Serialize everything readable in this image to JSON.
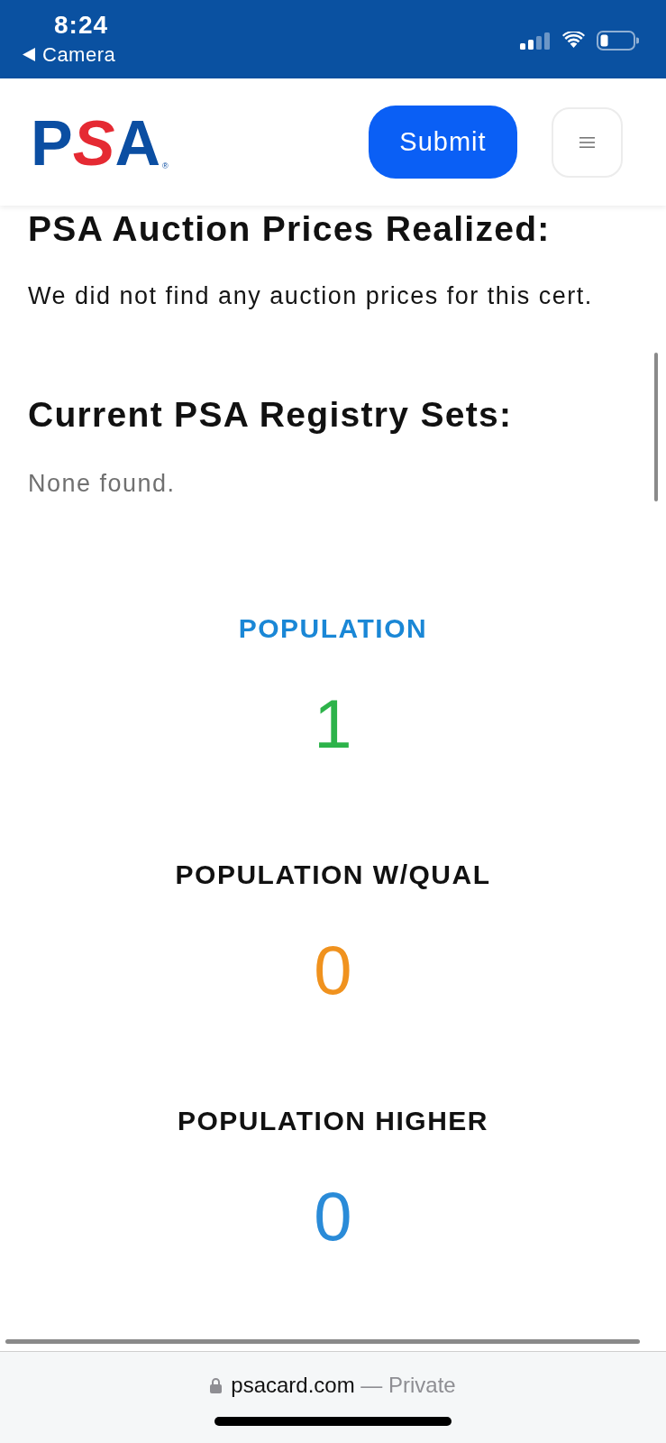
{
  "status_bar": {
    "time": "8:24",
    "back_label": "Camera"
  },
  "header": {
    "logo": {
      "letters": "PSA",
      "mark": "®"
    },
    "submit_button": "Submit"
  },
  "sections": [
    {
      "kind": "message",
      "title": "PSA Auction Prices Realized:",
      "body": "We did not find any auction prices for this cert."
    },
    {
      "kind": "empty",
      "title": "Current PSA Registry Sets:",
      "body": "None found."
    }
  ],
  "stats": [
    {
      "label": {
        "text": "POPULATION",
        "color": "#1a87d6"
      },
      "value": {
        "text": "1",
        "color": "#2db34a"
      }
    },
    {
      "label": {
        "text": "POPULATION W/QUAL",
        "color": "#111111"
      },
      "value": {
        "text": "0",
        "color": "#f0921e"
      }
    },
    {
      "label": {
        "text": "POPULATION HIGHER",
        "color": "#111111"
      },
      "value": {
        "text": "0",
        "color": "#2a8bd8"
      }
    }
  ],
  "browser_bar": {
    "domain": "psacard.com",
    "suffix": "— Private"
  }
}
